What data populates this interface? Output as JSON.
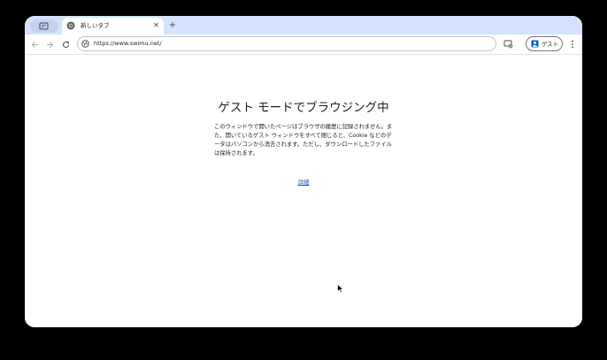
{
  "tab": {
    "title": "新しいタブ",
    "close_glyph": "✕"
  },
  "new_tab_glyph": "+",
  "omnibox": {
    "url": "https://www.swimu.net/"
  },
  "profile": {
    "label": "ゲスト"
  },
  "page": {
    "heading": "ゲスト モードでブラウジング中",
    "description": "このウィンドウで開いたページはブラウザの履歴に記録されません。また、開いているゲスト ウィンドウをすべて閉じると、Cookie などのデータはパソコンから消去されます。ただし、ダウンロードしたファイルは保持されます。",
    "learn_more": "詳細"
  },
  "colors": {
    "tabbar_background": "#d3e3fd",
    "link": "#0b57d0"
  }
}
